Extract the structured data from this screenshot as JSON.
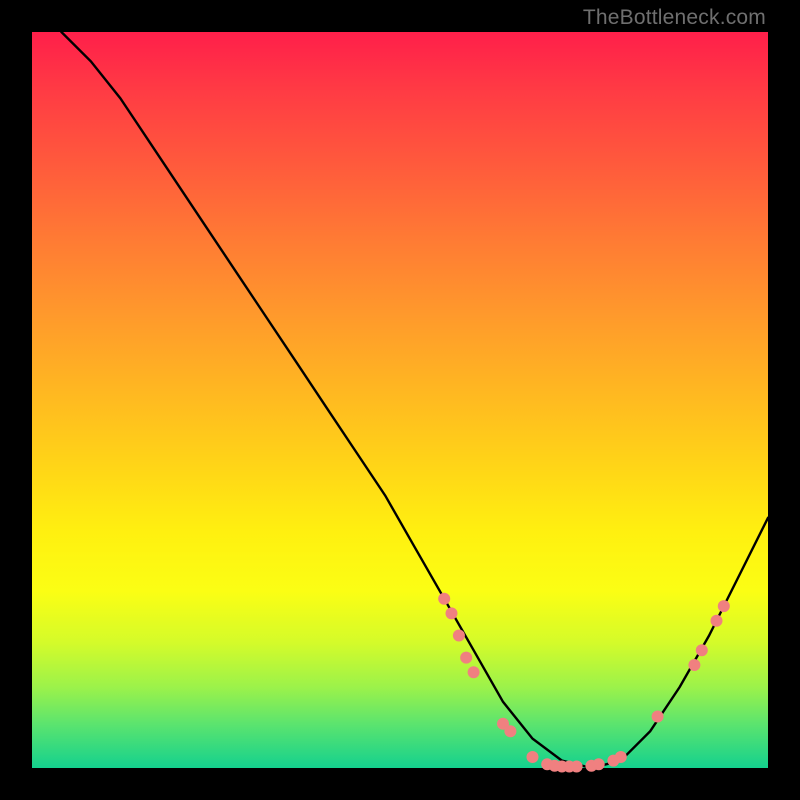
{
  "watermark": "TheBottleneck.com",
  "chart_data": {
    "type": "line",
    "title": "",
    "xlabel": "",
    "ylabel": "",
    "xlim": [
      0,
      100
    ],
    "ylim": [
      0,
      100
    ],
    "grid": false,
    "series": [
      {
        "name": "curve",
        "x": [
          4,
          8,
          12,
          16,
          20,
          24,
          28,
          32,
          36,
          40,
          44,
          48,
          52,
          56,
          60,
          64,
          68,
          72,
          76,
          80,
          84,
          88,
          92,
          96,
          100
        ],
        "y": [
          100,
          96,
          91,
          85,
          79,
          73,
          67,
          61,
          55,
          49,
          43,
          37,
          30,
          23,
          16,
          9,
          4,
          1,
          0,
          1,
          5,
          11,
          18,
          26,
          34
        ]
      }
    ],
    "highlight_points": [
      {
        "x": 56,
        "y": 23
      },
      {
        "x": 57,
        "y": 21
      },
      {
        "x": 58,
        "y": 18
      },
      {
        "x": 59,
        "y": 15
      },
      {
        "x": 60,
        "y": 13
      },
      {
        "x": 64,
        "y": 6
      },
      {
        "x": 65,
        "y": 5
      },
      {
        "x": 68,
        "y": 1.5
      },
      {
        "x": 70,
        "y": 0.5
      },
      {
        "x": 71,
        "y": 0.3
      },
      {
        "x": 72,
        "y": 0.2
      },
      {
        "x": 73,
        "y": 0.2
      },
      {
        "x": 74,
        "y": 0.2
      },
      {
        "x": 76,
        "y": 0.3
      },
      {
        "x": 77,
        "y": 0.5
      },
      {
        "x": 79,
        "y": 1
      },
      {
        "x": 80,
        "y": 1.5
      },
      {
        "x": 85,
        "y": 7
      },
      {
        "x": 90,
        "y": 14
      },
      {
        "x": 91,
        "y": 16
      },
      {
        "x": 93,
        "y": 20
      },
      {
        "x": 94,
        "y": 22
      }
    ],
    "point_color": "#f08080",
    "curve_color": "#000000"
  }
}
